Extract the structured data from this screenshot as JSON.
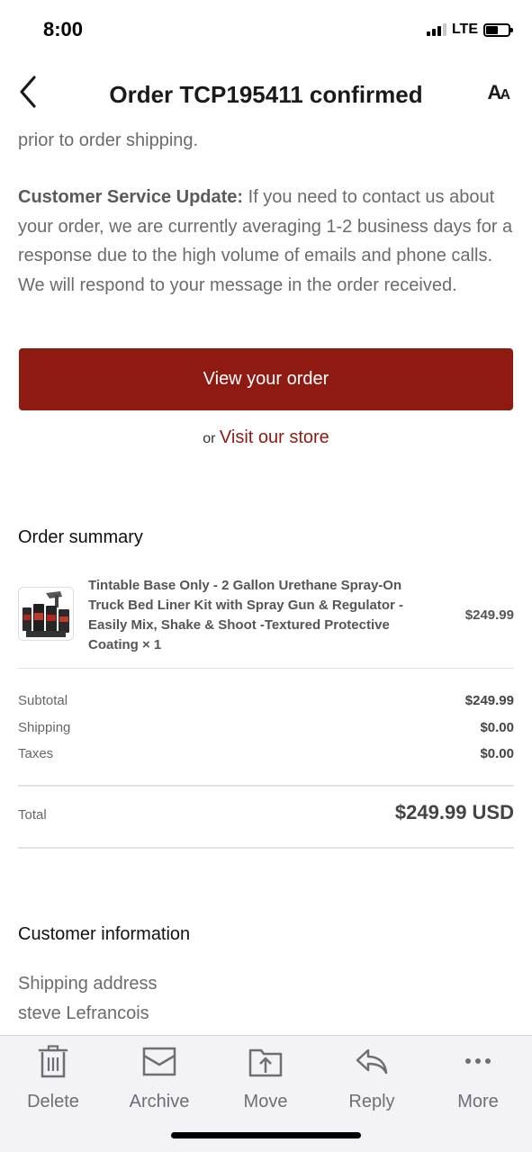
{
  "status_bar": {
    "time": "8:00",
    "network": "LTE",
    "signal_bars": 3,
    "battery_level": 0.55
  },
  "header": {
    "title": "Order TCP195411 confirmed",
    "back_icon": "chevron-left-icon",
    "text_size_icon": "text-size-icon",
    "text_size_label_large": "A",
    "text_size_label_small": "A"
  },
  "message": {
    "fragment": "prior to order shipping.",
    "update_heading": "Customer Service Update:",
    "update_body": " If you need to contact us about your order, we are currently averaging 1-2 business days for a response due to the high volume of emails and phone calls. We will respond to your message in the order received.",
    "view_order_label": "View your order",
    "or_text": "or",
    "visit_store_label": "Visit our store"
  },
  "order_summary": {
    "title": "Order summary",
    "item": {
      "name": "Tintable Base Only - 2 Gallon Urethane Spray-On Truck Bed Liner Kit with Spray Gun & Regulator - Easily Mix, Shake & Shoot -Textured Protective Coating × 1",
      "price": "$249.99"
    },
    "subtotal_label": "Subtotal",
    "subtotal_value": "$249.99",
    "shipping_label": "Shipping",
    "shipping_value": "$0.00",
    "taxes_label": "Taxes",
    "taxes_value": "$0.00",
    "total_label": "Total",
    "total_value": "$249.99 USD"
  },
  "customer_info": {
    "title": "Customer information",
    "shipping_address_label": "Shipping address",
    "shipping_name": "steve Lefrancois"
  },
  "toolbar": {
    "delete": "Delete",
    "archive": "Archive",
    "move": "Move",
    "reply": "Reply",
    "more": "More"
  },
  "colors": {
    "accent": "#8f1a12",
    "toolbar_bg": "#f2f2f7",
    "text_gray": "#6b6b6b"
  }
}
